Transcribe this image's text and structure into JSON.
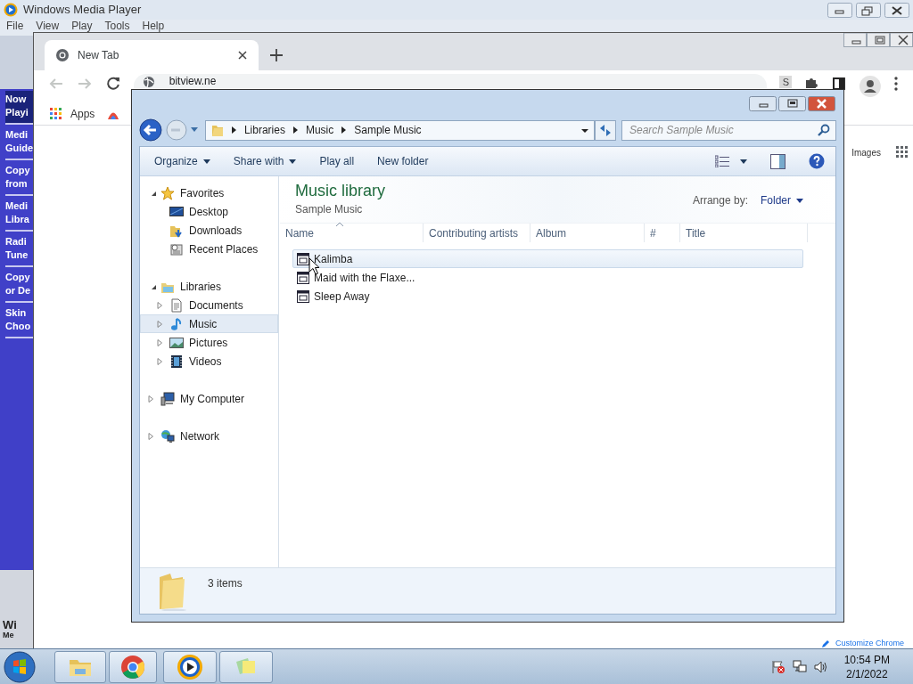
{
  "wmp": {
    "title": "Windows Media Player",
    "menu": [
      "File",
      "View",
      "Play",
      "Tools",
      "Help"
    ],
    "sidebar": [
      {
        "lines": [
          "Now",
          "Playi"
        ],
        "selected": true
      },
      {
        "lines": [
          "Medi",
          "Guide"
        ],
        "selected": false
      },
      {
        "lines": [
          "Copy",
          "from"
        ],
        "selected": false
      },
      {
        "lines": [
          "Medi",
          "Libra"
        ],
        "selected": false
      },
      {
        "lines": [
          "Radi",
          "Tune"
        ],
        "selected": false
      },
      {
        "lines": [
          "Copy",
          "or De"
        ],
        "selected": false
      },
      {
        "lines": [
          "Skin",
          "Choo"
        ],
        "selected": false
      }
    ],
    "logo_lines": [
      "Wi",
      "Me"
    ]
  },
  "chrome": {
    "tab": {
      "title": "New Tab"
    },
    "address": "bitview.ne",
    "extension_letter": "S",
    "bookmarks": [
      "Apps"
    ],
    "links": [
      "Images"
    ],
    "customize": "Customize Chrome"
  },
  "explorer": {
    "breadcrumb": [
      "Libraries",
      "Music",
      "Sample Music"
    ],
    "search": {
      "placeholder": "Search Sample Music"
    },
    "commands": [
      {
        "label": "Organize",
        "menu": true
      },
      {
        "label": "Share with",
        "menu": true
      },
      {
        "label": "Play all",
        "menu": false
      },
      {
        "label": "New folder",
        "menu": false
      }
    ],
    "tree": [
      {
        "label": "Favorites",
        "kind": "favorites",
        "expanded": true,
        "selected": false,
        "children": [
          {
            "label": "Desktop",
            "kind": "desktop",
            "selected": false
          },
          {
            "label": "Downloads",
            "kind": "downloads",
            "selected": false
          },
          {
            "label": "Recent Places",
            "kind": "recent",
            "selected": false
          }
        ]
      },
      {
        "label": "Libraries",
        "kind": "libraries",
        "expanded": true,
        "selected": false,
        "children": [
          {
            "label": "Documents",
            "kind": "documents",
            "expanded": false,
            "selected": false
          },
          {
            "label": "Music",
            "kind": "music",
            "expanded": false,
            "selected": true
          },
          {
            "label": "Pictures",
            "kind": "pictures",
            "expanded": false,
            "selected": false
          },
          {
            "label": "Videos",
            "kind": "videos",
            "expanded": false,
            "selected": false
          }
        ]
      },
      {
        "label": "My Computer",
        "kind": "computer",
        "expanded": false,
        "selected": false
      },
      {
        "label": "Network",
        "kind": "network",
        "expanded": false,
        "selected": false
      }
    ],
    "library": {
      "title": "Music library",
      "subtitle": "Sample Music",
      "arrange_label": "Arrange by:",
      "arrange_value": "Folder"
    },
    "columns": [
      "Name",
      "Contributing artists",
      "Album",
      "#",
      "Title"
    ],
    "files": [
      {
        "name": "Kalimba",
        "selected": true
      },
      {
        "name": "Maid with the Flaxe...",
        "selected": false
      },
      {
        "name": "Sleep Away",
        "selected": false
      }
    ],
    "status": "3 items"
  },
  "taskbar": {
    "buttons": [
      {
        "kind": "explorer"
      },
      {
        "kind": "chrome"
      },
      {
        "kind": "wmp"
      },
      {
        "kind": "notes"
      }
    ],
    "clock": {
      "time": "10:54 PM",
      "date": "2/1/2022"
    }
  }
}
